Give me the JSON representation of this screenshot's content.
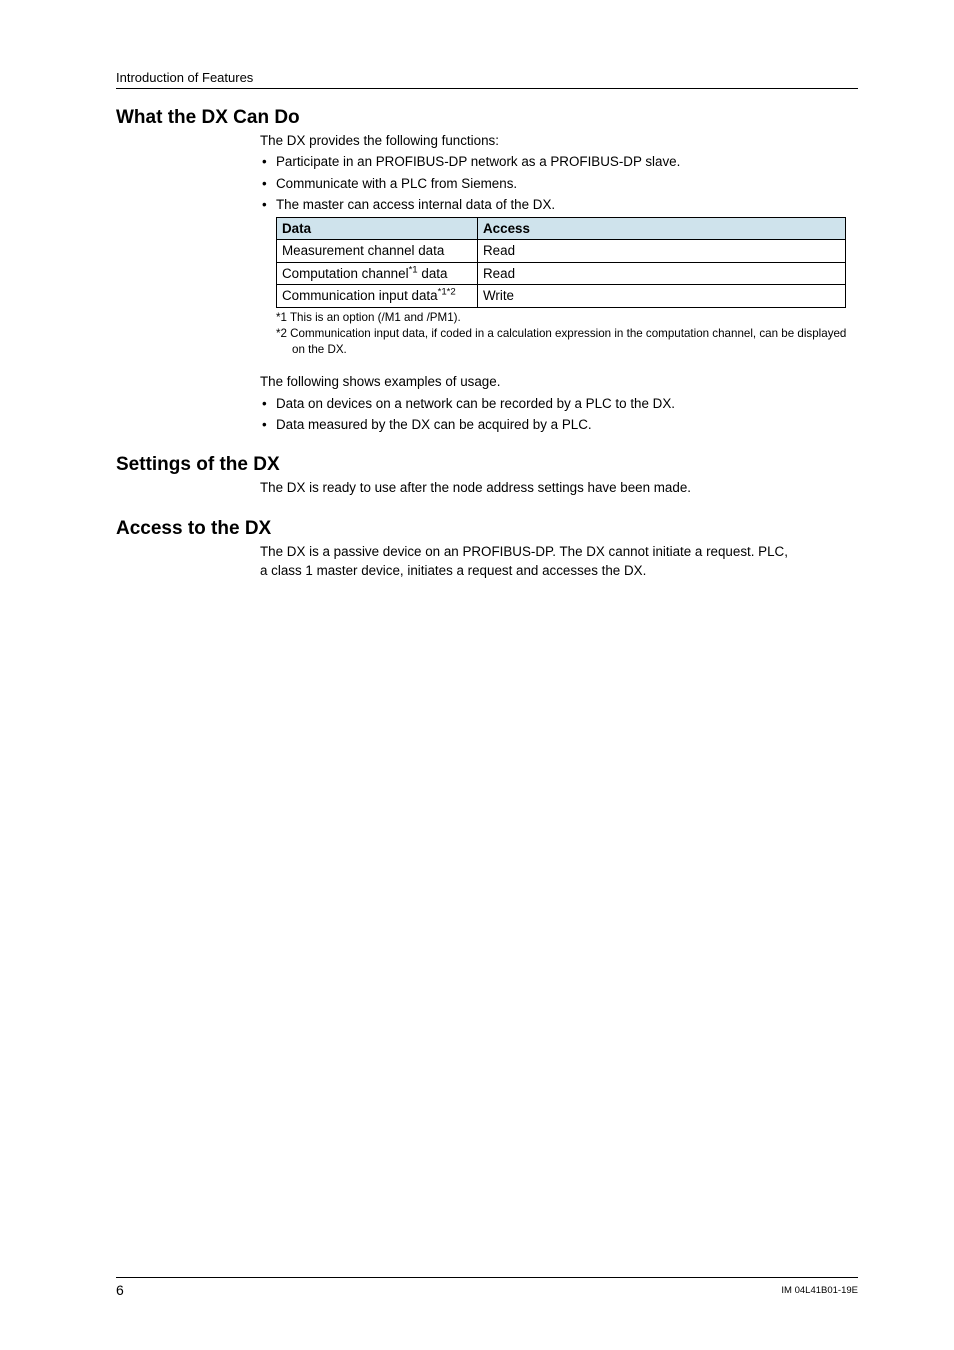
{
  "runningHead": "Introduction of Features",
  "sec1": {
    "title": "What the DX Can Do",
    "intro": "The DX provides the following functions:",
    "bullets": [
      "Participate in an PROFIBUS-DP network as a PROFIBUS-DP slave.",
      "Communicate with a PLC from Siemens.",
      "The master can access internal data of the DX."
    ],
    "table": {
      "headers": [
        "Data",
        "Access"
      ],
      "rows": [
        {
          "cells": [
            "Measurement channel data",
            "Read"
          ],
          "sup": ""
        },
        {
          "cells": [
            "Computation channel",
            "Read"
          ],
          "supAfter": "*1",
          "tail": " data"
        },
        {
          "cells": [
            "Communication input data",
            "Write"
          ],
          "supAfter": "*1*2",
          "tail": ""
        }
      ]
    },
    "notes": [
      "*1 This is an option (/M1 and /PM1).",
      "*2 Communication input data, if coded in a calculation expression in the computation channel, can be displayed on the DX."
    ],
    "examplesIntro": "The following shows examples of usage.",
    "examples": [
      "Data on devices on a network can be recorded by a PLC to the DX.",
      "Data measured by the DX can be acquired by a PLC."
    ]
  },
  "sec2": {
    "title": "Settings of the DX",
    "body": "The DX is ready to use after the node address settings have been made."
  },
  "sec3": {
    "title": "Access to the DX",
    "body1": "The DX is a passive device on an PROFIBUS-DP. The DX cannot initiate a request. PLC,",
    "body2": "a class 1 master device, initiates a request and accesses the DX."
  },
  "footer": {
    "pageNum": "6",
    "docId": "IM 04L41B01-19E"
  }
}
